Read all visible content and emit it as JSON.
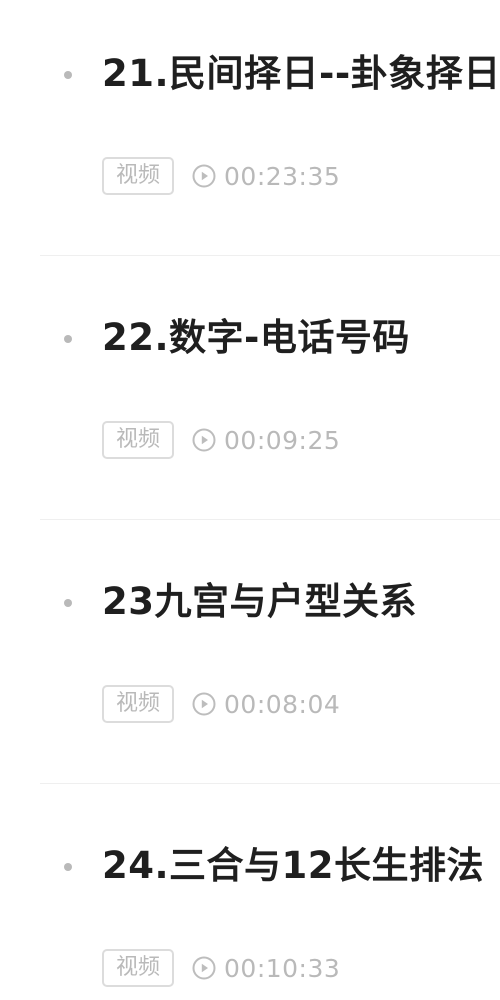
{
  "lessons": [
    {
      "title": "21.民间择日--卦象择日",
      "tag": "视频",
      "duration": "00:23:35"
    },
    {
      "title": "22.数字-电话号码",
      "tag": "视频",
      "duration": "00:09:25"
    },
    {
      "title": "23九宫与户型关系",
      "tag": "视频",
      "duration": "00:08:04"
    },
    {
      "title": "24.三合与12长生排法",
      "tag": "视频",
      "duration": "00:10:33"
    }
  ],
  "icons": {
    "bullet": "dot",
    "duration": "play-circle-icon"
  },
  "colors": {
    "title": "#1f1f1f",
    "meta": "#b9b9b9",
    "tag_border": "#dcdcdc",
    "background": "#ffffff"
  }
}
